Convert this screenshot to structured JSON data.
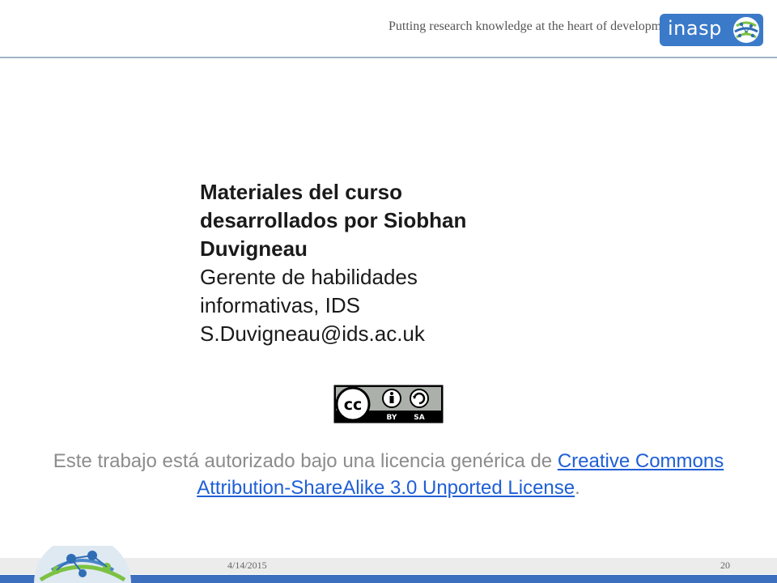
{
  "header": {
    "tagline": "Putting research knowledge at the heart of development",
    "logo_text": "inasp"
  },
  "credits": {
    "line1": "Materiales del curso",
    "line2": "desarrollados por Siobhan",
    "line3": "Duvigneau",
    "line4": "Gerente de habilidades",
    "line5": "informativas, IDS",
    "line6": "S.Duvigneau@ids.ac.uk"
  },
  "badge": {
    "icon": "creative-commons-by-sa-icon",
    "by": "BY",
    "sa": "SA"
  },
  "license": {
    "text_before": "Este trabajo está autorizado bajo una licencia genérica de ",
    "link_text": "Creative Commons Attribution-ShareAlike 3.0 Unported License",
    "text_after": "."
  },
  "footer": {
    "date": "4/14/2015",
    "page_number": "20"
  },
  "colors": {
    "link": "#1f5fd6",
    "brand_blue": "#3b7ac9",
    "footer_band": "#3c6fbe"
  }
}
